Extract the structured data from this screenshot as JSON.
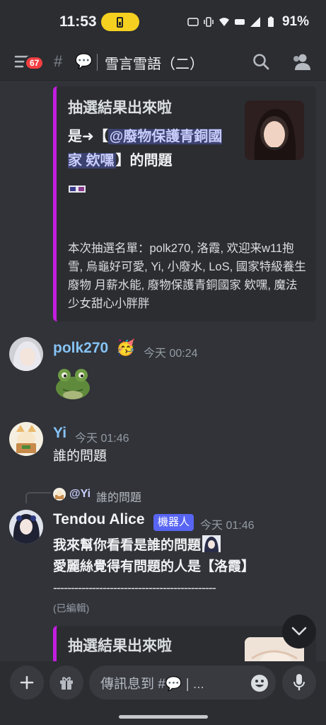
{
  "status_bar": {
    "time": "11:53",
    "battery_pct": "91%"
  },
  "header": {
    "unread_count": "67",
    "channel_hash": "#",
    "channel_name": "雪言雪語（二）",
    "icons": [
      "menu-icon",
      "speech-bubble-icon",
      "search-icon",
      "members-icon"
    ]
  },
  "embed1": {
    "title": "抽選結果出來啦",
    "desc_prefix": "是➜【",
    "mention": "@廢物保護青銅國家 欸嘿",
    "desc_suffix": "】的問題",
    "list": "本次抽選名單：polk270, 洛霞, 欢迎来w11抱雪, 烏龜好可愛, Yi, 小廢水, LoS, 國家特級養生廢物 月薪水能, 廢物保護青銅國家 欸嘿, 魔法少女甜心小胖胖"
  },
  "messages": [
    {
      "username": "polk270",
      "name_color": "#86c3f5",
      "timestamp": "今天 00:24",
      "content": ""
    },
    {
      "username": "Yi",
      "name_color": "#86c3f5",
      "timestamp": "今天 01:46",
      "content": "誰的問題"
    },
    {
      "reply_to_name": "@Yi",
      "reply_to_text": "誰的問題",
      "username": "Tendou Alice",
      "name_color": "#f2f3f5",
      "bot_tag": "機器人",
      "timestamp": "今天 01:46",
      "line1": "我來幫你看看是誰的問題",
      "line2": "愛麗絲覺得有問題的人是【洛霞】",
      "dashes": "----------------------------------------------",
      "edited": "(已編輯)"
    }
  ],
  "embed2": {
    "title": "抽選結果出來啦"
  },
  "input": {
    "placeholder": "傳訊息到 #💬 | ..."
  },
  "colors": {
    "accent_bar": "#c31de0",
    "bot_tag": "#5865f2",
    "badge": "#f23f42"
  }
}
